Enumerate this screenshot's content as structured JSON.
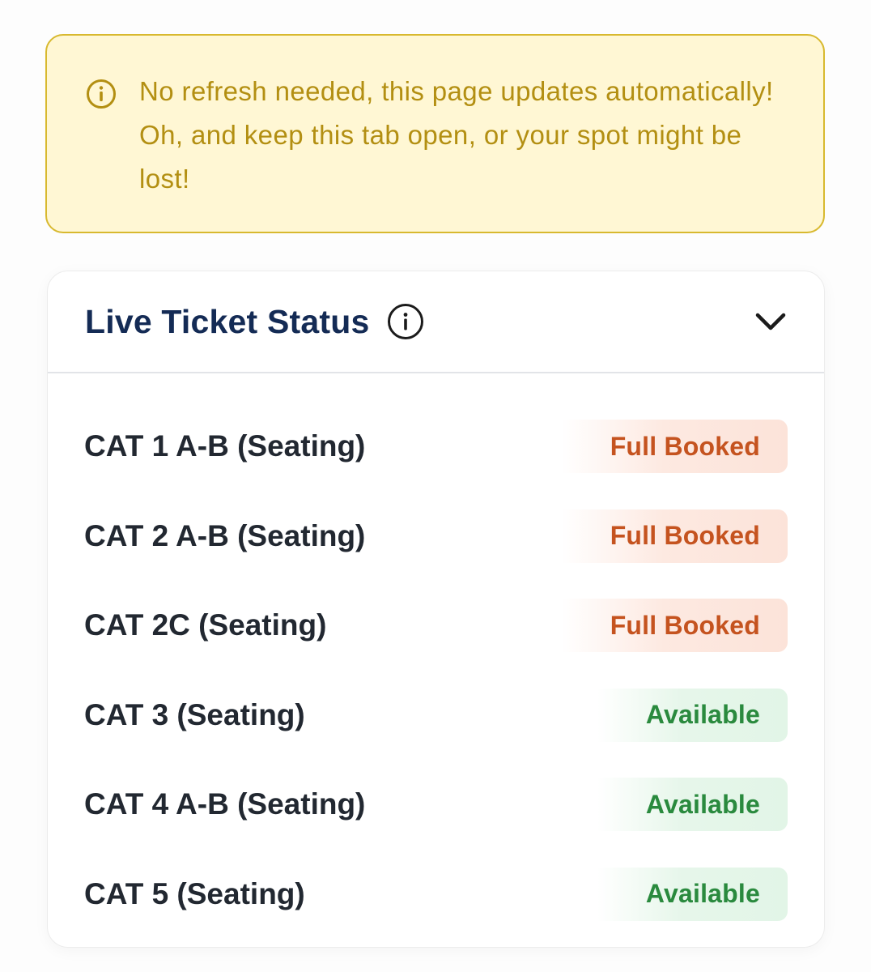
{
  "notice": {
    "icon": "info-icon",
    "text": "No refresh needed, this page updates automatically! Oh, and keep this tab open, or your spot might be lost!",
    "colors": {
      "background": "#fff7d4",
      "border": "#d8b92f",
      "text": "#b38f12"
    }
  },
  "ticket_status": {
    "title": "Live Ticket Status",
    "title_icon": "info-icon",
    "toggle_icon": "chevron-down-icon",
    "rows": [
      {
        "label": "CAT 1 A-B (Seating)",
        "status": "Full Booked",
        "state": "booked"
      },
      {
        "label": "CAT 2 A-B (Seating)",
        "status": "Full Booked",
        "state": "booked"
      },
      {
        "label": "CAT 2C (Seating)",
        "status": "Full Booked",
        "state": "booked"
      },
      {
        "label": "CAT 3 (Seating)",
        "status": "Available",
        "state": "available"
      },
      {
        "label": "CAT 4 A-B (Seating)",
        "status": "Available",
        "state": "available"
      },
      {
        "label": "CAT 5 (Seating)",
        "status": "Available",
        "state": "available"
      }
    ],
    "colors": {
      "title": "#142b55",
      "booked": "#c5531f",
      "available": "#2a8a3e"
    }
  }
}
